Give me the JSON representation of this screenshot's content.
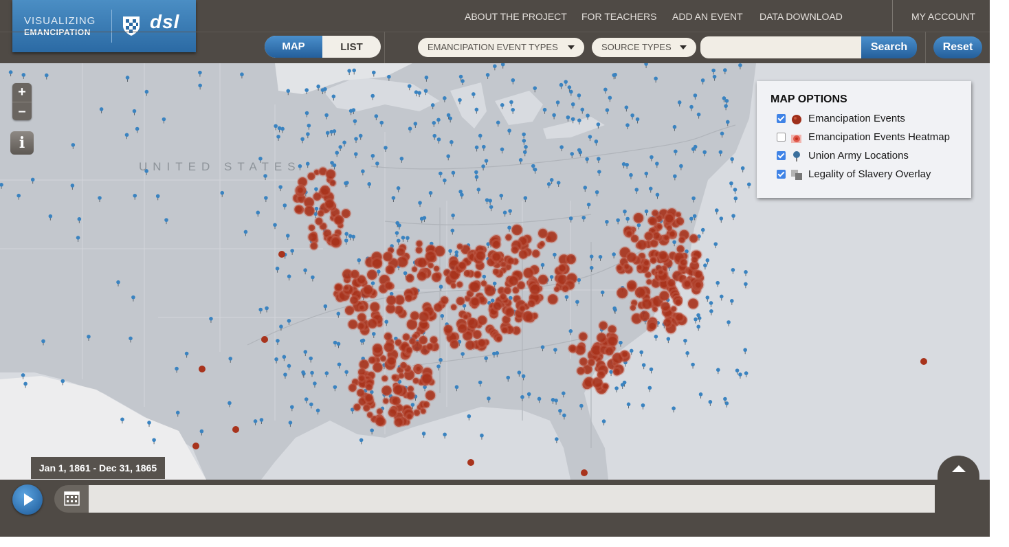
{
  "logo": {
    "line1": "VISUALIZING",
    "line2": "EMANCIPATION",
    "brand": "dsl"
  },
  "nav": {
    "about": "ABOUT THE PROJECT",
    "teachers": "FOR TEACHERS",
    "add_event": "ADD AN EVENT",
    "download": "DATA DOWNLOAD",
    "account": "MY ACCOUNT"
  },
  "view_toggle": {
    "map": "MAP",
    "list": "LIST",
    "selected": "MAP"
  },
  "filters": {
    "event_types": "EMANCIPATION EVENT TYPES",
    "source_types": "SOURCE TYPES"
  },
  "search": {
    "value": "",
    "button": "Search",
    "reset": "Reset"
  },
  "map": {
    "country_label": "UNITED STATES",
    "zoom_in": "+",
    "zoom_out": "–",
    "info": "i"
  },
  "map_options": {
    "title": "MAP OPTIONS",
    "items": [
      {
        "label": "Emancipation Events",
        "checked": true,
        "icon": "red-dot-icon"
      },
      {
        "label": "Emancipation Events Heatmap",
        "checked": false,
        "icon": "heatmap-icon"
      },
      {
        "label": "Union Army Locations",
        "checked": true,
        "icon": "blue-pin-icon"
      },
      {
        "label": "Legality of Slavery Overlay",
        "checked": true,
        "icon": "gray-squares-icon"
      }
    ]
  },
  "timeline": {
    "date_range": "Jan 1, 1861 - Dec 31, 1865"
  },
  "colors": {
    "event_red": "#a8331c",
    "pin_blue": "#3a83c0",
    "accent_blue": "#2b6aa4",
    "chrome": "#4f4a45"
  }
}
